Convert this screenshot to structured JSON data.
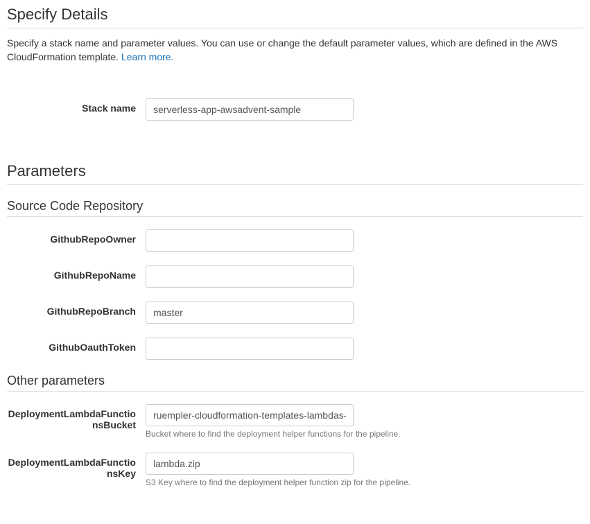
{
  "header": {
    "title": "Specify Details",
    "description_pre": "Specify a stack name and parameter values. You can use or change the default parameter values, which are defined in the AWS CloudFormation template. ",
    "learn_more": "Learn more."
  },
  "stack": {
    "label": "Stack name",
    "value": "serverless-app-awsadvent-sample"
  },
  "parameters": {
    "title": "Parameters",
    "groups": {
      "source": {
        "title": "Source Code Repository",
        "fields": {
          "owner": {
            "label": "GithubRepoOwner",
            "value": ""
          },
          "name": {
            "label": "GithubRepoName",
            "value": ""
          },
          "branch": {
            "label": "GithubRepoBranch",
            "value": "master"
          },
          "token": {
            "label": "GithubOauthToken",
            "value": ""
          }
        }
      },
      "other": {
        "title": "Other parameters",
        "fields": {
          "bucket": {
            "label": "DeploymentLambdaFunctionsBucket",
            "value": "ruempler-cloudformation-templates-lambdas-production",
            "help": "Bucket where to find the deployment helper functions for the pipeline."
          },
          "key": {
            "label": "DeploymentLambdaFunctionsKey",
            "value": "lambda.zip",
            "help": "S3 Key where to find the deployment helper function zip for the pipeline."
          }
        }
      }
    }
  }
}
